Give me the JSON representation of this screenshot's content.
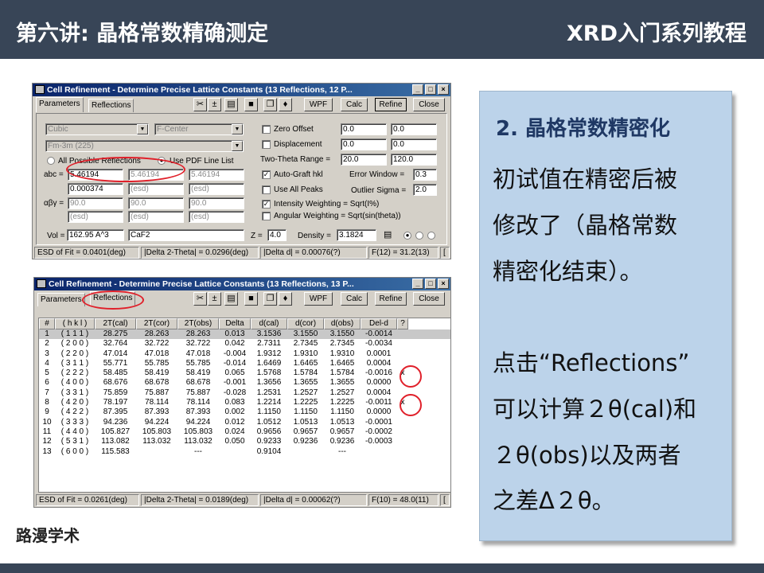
{
  "header": {
    "left": "第六讲: 晶格常数精确测定",
    "right": "XRD入门系列教程"
  },
  "brand": "路漫学术",
  "window1": {
    "title": "Cell Refinement - Determine Precise Lattice Constants (13 Reflections, 12 P...",
    "tabs": [
      "Parameters",
      "Reflections"
    ],
    "buttons": [
      "WPF",
      "Calc",
      "Refine",
      "Close"
    ],
    "system": "Cubic",
    "centering": "F-Center",
    "spacegroup": "Fm-3m (225)",
    "radio1": "All Possible Reflections",
    "radio2": "Use PDF Line List",
    "abc_label": "abc =",
    "abc": [
      "5.46194",
      "5.46194",
      "5.46194"
    ],
    "abc_esd": [
      "0.000374",
      "(esd)",
      "(esd)"
    ],
    "abg_label": "αβγ =",
    "abg": [
      "90.0",
      "90.0",
      "90.0"
    ],
    "abg_esd": [
      "(esd)",
      "(esd)",
      "(esd)"
    ],
    "zero_offset": {
      "label": "Zero Offset",
      "v1": "0.0",
      "v2": "0.0"
    },
    "displacement": {
      "label": "Displacement",
      "v1": "0.0",
      "v2": "0.0"
    },
    "two_theta": {
      "label": "Two-Theta Range =",
      "v1": "20.0",
      "v2": "120.0"
    },
    "autograft": {
      "label": "Auto-Graft hkl",
      "win_label": "Error Window =",
      "win": "0.3"
    },
    "allpeaks": {
      "label": "Use All Peaks",
      "sig_label": "Outlier Sigma =",
      "sig": "2.0"
    },
    "intensity": "Intensity Weighting = Sqrt(I%)",
    "angular": "Angular Weighting = Sqrt(sin(theta))",
    "vol_label": "Vol =",
    "vol": "162.95 A^3",
    "formula": "CaF2",
    "z_label": "Z =",
    "z": "4.0",
    "density_label": "Density =",
    "density": "3.1824",
    "status": [
      "ESD of Fit = 0.0401(deg)",
      "|Delta 2-Theta| = 0.0296(deg)",
      "|Delta d| = 0.00076(?)",
      "F(12) = 31.2(13)",
      "["
    ]
  },
  "window2": {
    "title": "Cell Refinement - Determine Precise Lattice Constants (13 Reflections, 13 P...",
    "tabs": [
      "Parameters",
      "Reflections"
    ],
    "buttons": [
      "WPF",
      "Calc",
      "Refine",
      "Close"
    ],
    "columns": [
      "#",
      "( h k l )",
      "2T(cal)",
      "2T(cor)",
      "2T(obs)",
      "Delta",
      "d(cal)",
      "d(cor)",
      "d(obs)",
      "Del-d",
      "?"
    ],
    "rows": [
      [
        "1",
        "( 1 1 1 )",
        "28.275",
        "28.263",
        "28.263",
        "0.013",
        "3.1536",
        "3.1550",
        "3.1550",
        "-0.0014",
        ""
      ],
      [
        "2",
        "( 2 0 0 )",
        "32.764",
        "32.722",
        "32.722",
        "0.042",
        "2.7311",
        "2.7345",
        "2.7345",
        "-0.0034",
        ""
      ],
      [
        "3",
        "( 2 2 0 )",
        "47.014",
        "47.018",
        "47.018",
        "-0.004",
        "1.9312",
        "1.9310",
        "1.9310",
        "0.0001",
        ""
      ],
      [
        "4",
        "( 3 1 1 )",
        "55.771",
        "55.785",
        "55.785",
        "-0.014",
        "1.6469",
        "1.6465",
        "1.6465",
        "0.0004",
        ""
      ],
      [
        "5",
        "( 2 2 2 )",
        "58.485",
        "58.419",
        "58.419",
        "0.065",
        "1.5768",
        "1.5784",
        "1.5784",
        "-0.0016",
        "x"
      ],
      [
        "6",
        "( 4 0 0 )",
        "68.676",
        "68.678",
        "68.678",
        "-0.001",
        "1.3656",
        "1.3655",
        "1.3655",
        "0.0000",
        ""
      ],
      [
        "7",
        "( 3 3 1 )",
        "75.859",
        "75.887",
        "75.887",
        "-0.028",
        "1.2531",
        "1.2527",
        "1.2527",
        "0.0004",
        ""
      ],
      [
        "8",
        "( 4 2 0 )",
        "78.197",
        "78.114",
        "78.114",
        "0.083",
        "1.2214",
        "1.2225",
        "1.2225",
        "-0.0011",
        "x"
      ],
      [
        "9",
        "( 4 2 2 )",
        "87.395",
        "87.393",
        "87.393",
        "0.002",
        "1.1150",
        "1.1150",
        "1.1150",
        "0.0000",
        ""
      ],
      [
        "10",
        "( 3 3 3 )",
        "94.236",
        "94.224",
        "94.224",
        "0.012",
        "1.0512",
        "1.0513",
        "1.0513",
        "-0.0001",
        ""
      ],
      [
        "11",
        "( 4 4 0 )",
        "105.827",
        "105.803",
        "105.803",
        "0.024",
        "0.9656",
        "0.9657",
        "0.9657",
        "-0.0002",
        ""
      ],
      [
        "12",
        "( 5 3 1 )",
        "113.082",
        "113.032",
        "113.032",
        "0.050",
        "0.9233",
        "0.9236",
        "0.9236",
        "-0.0003",
        ""
      ],
      [
        "13",
        "( 6 0 0 )",
        "115.583",
        "",
        "---",
        "",
        "0.9104",
        "",
        "---",
        "",
        ""
      ]
    ],
    "status": [
      "ESD of Fit = 0.0261(deg)",
      "|Delta 2-Theta| = 0.0189(deg)",
      "|Delta d| = 0.00062(?)",
      "F(10) = 48.0(11)",
      "["
    ]
  },
  "note": {
    "heading": "2. 晶格常数精密化",
    "lines": [
      "初试值在精密后被",
      "修改了（晶格常数",
      "精密化结束）。",
      "",
      "点击“Reflections”",
      "可以计算２θ(cal)和",
      "２θ(obs)以及两者",
      "之差Δ２θ。"
    ]
  }
}
